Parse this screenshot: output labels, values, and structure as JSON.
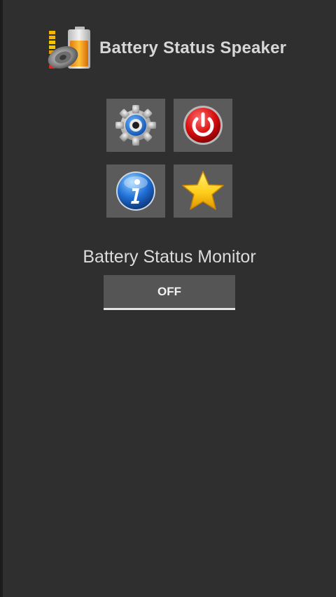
{
  "header": {
    "title": "Battery Status Speaker",
    "logo_icon": "battery-speaker-icon"
  },
  "tiles": [
    {
      "name": "settings",
      "icon": "gear-icon"
    },
    {
      "name": "power",
      "icon": "power-icon"
    },
    {
      "name": "info",
      "icon": "info-icon"
    },
    {
      "name": "rate",
      "icon": "star-icon"
    }
  ],
  "monitor": {
    "label": "Battery Status Monitor",
    "toggle_label": "OFF"
  },
  "colors": {
    "background": "#2f2f2f",
    "tile": "#5b5b5b",
    "text": "#dcdcdc",
    "toggle_underline": "#e5e5e5"
  }
}
